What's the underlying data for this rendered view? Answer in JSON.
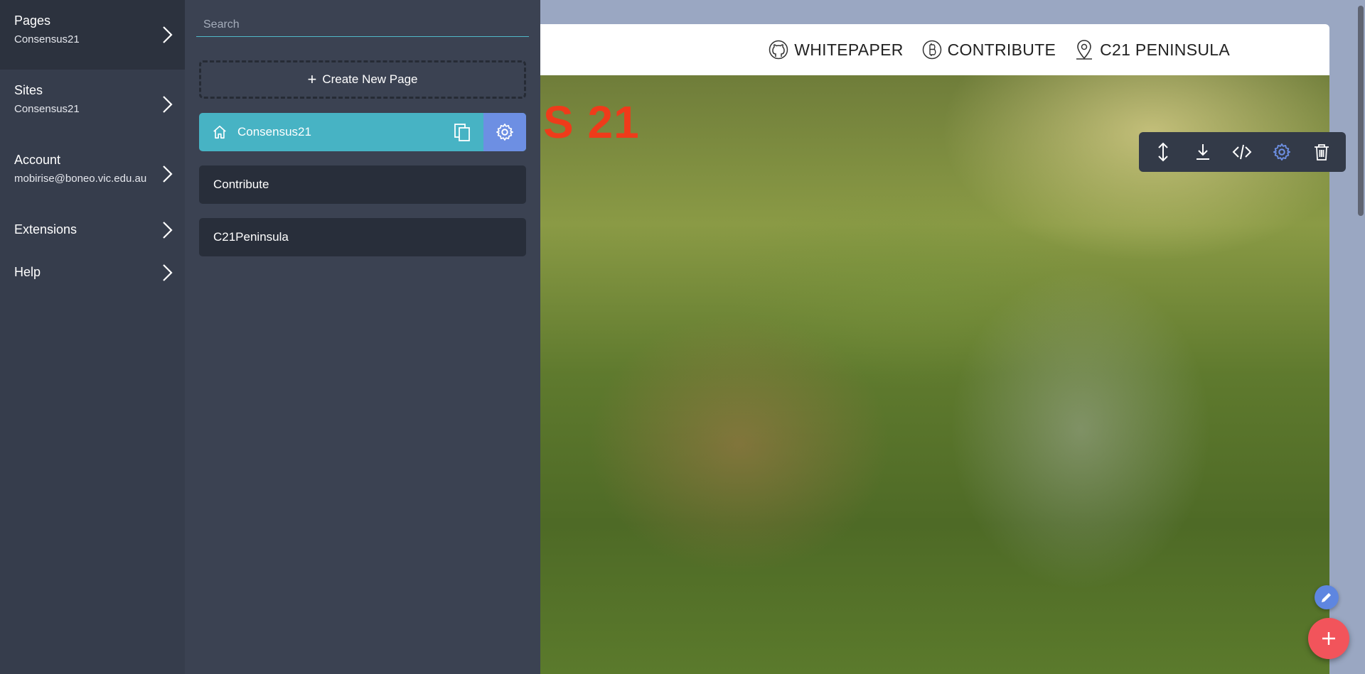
{
  "sidebar": {
    "items": [
      {
        "label": "Pages",
        "sub": "Consensus21"
      },
      {
        "label": "Sites",
        "sub": "Consensus21"
      },
      {
        "label": "Account",
        "sub": "mobirise@boneo.vic.edu.au"
      },
      {
        "label": "Extensions"
      },
      {
        "label": "Help"
      }
    ]
  },
  "panel": {
    "search_placeholder": "Search",
    "create_label": "Create New Page",
    "pages": [
      {
        "label": "Consensus21",
        "active": true,
        "home": true
      },
      {
        "label": "Contribute"
      },
      {
        "label": "C21Peninsula"
      }
    ]
  },
  "preview": {
    "nav": {
      "links": [
        {
          "label": "WHITEPAPER",
          "icon": "github-icon"
        },
        {
          "label": "CONTRIBUTE",
          "icon": "bitcoin-icon"
        },
        {
          "label": "C21 PENINSULA",
          "icon": "map-pin-icon"
        }
      ]
    },
    "hero_title_fragment": "S 21",
    "toolbar": [
      "move-icon",
      "download-icon",
      "code-icon",
      "gear-icon",
      "trash-icon"
    ]
  },
  "colors": {
    "sidebar_bg": "#363d4c",
    "panel_bg": "#3b4252",
    "active_page": "#47b3c4",
    "gear_btn": "#6d8fe3",
    "title_red": "#ef3b1a",
    "fab_red": "#f2545b",
    "fab_blue": "#5e86e0"
  }
}
